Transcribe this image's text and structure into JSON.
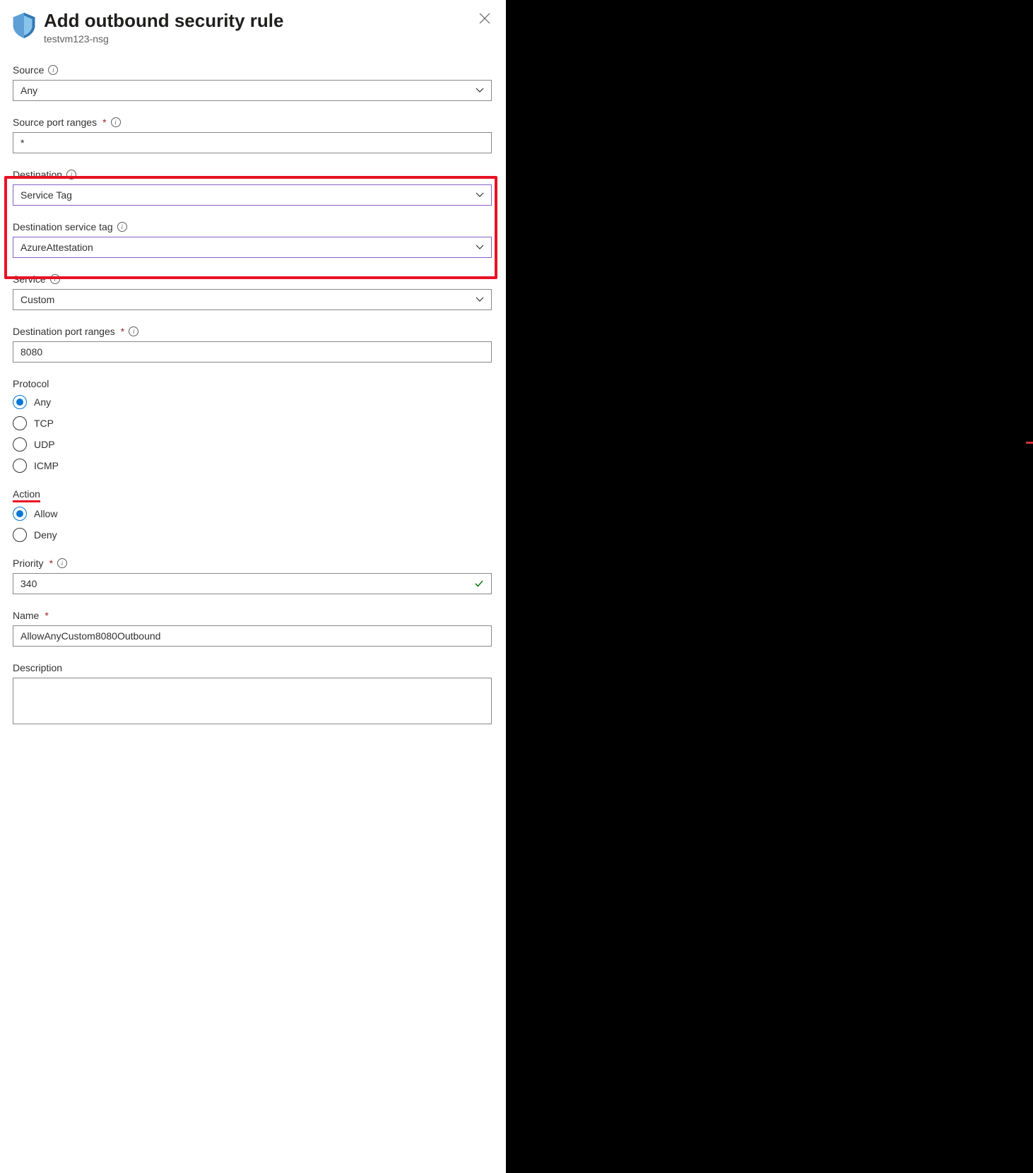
{
  "header": {
    "title": "Add outbound security rule",
    "subtitle": "testvm123-nsg"
  },
  "fields": {
    "source": {
      "label": "Source",
      "value": "Any"
    },
    "sourcePortRanges": {
      "label": "Source port ranges",
      "value": "*"
    },
    "destination": {
      "label": "Destination",
      "value": "Service Tag"
    },
    "destinationServiceTag": {
      "label": "Destination service tag",
      "value": "AzureAttestation"
    },
    "service": {
      "label": "Service",
      "value": "Custom"
    },
    "destinationPortRanges": {
      "label": "Destination port ranges",
      "value": "8080"
    },
    "protocol": {
      "label": "Protocol",
      "options": [
        "Any",
        "TCP",
        "UDP",
        "ICMP"
      ],
      "selected": "Any"
    },
    "action": {
      "label": "Action",
      "options": [
        "Allow",
        "Deny"
      ],
      "selected": "Allow"
    },
    "priority": {
      "label": "Priority",
      "value": "340"
    },
    "name": {
      "label": "Name",
      "value": "AllowAnyCustom8080Outbound"
    },
    "description": {
      "label": "Description",
      "value": ""
    }
  }
}
